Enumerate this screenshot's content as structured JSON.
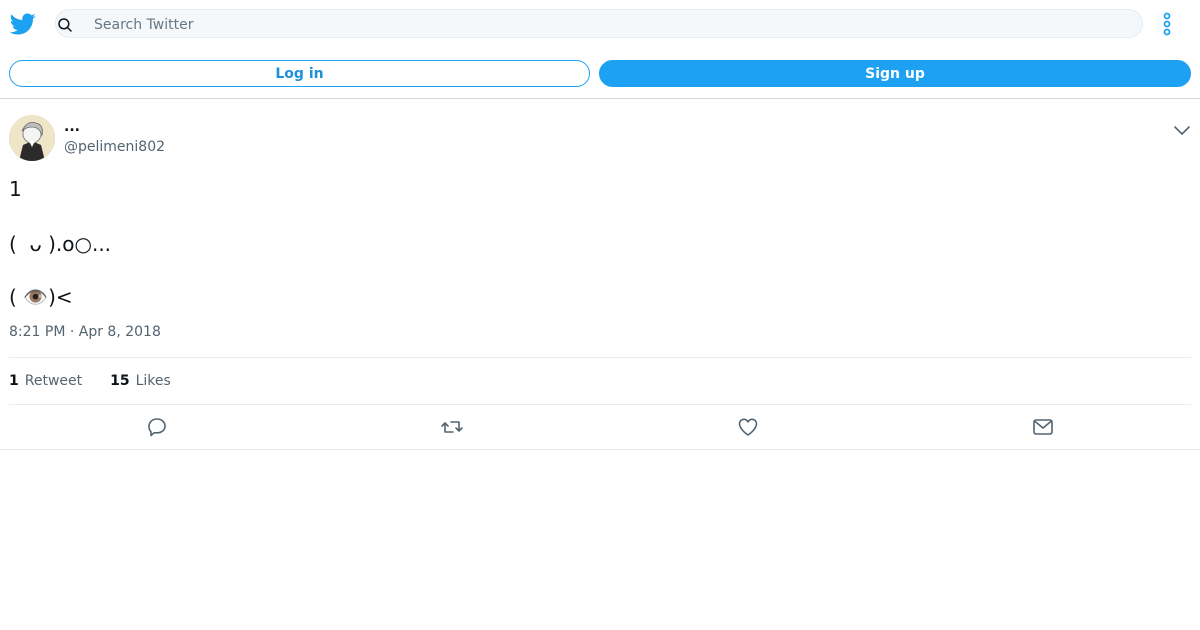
{
  "header": {
    "search_placeholder": "Search Twitter",
    "icons": {
      "logo": "twitter-bird-icon",
      "search": "search-icon",
      "more": "more-vertical-icon"
    }
  },
  "auth": {
    "login_label": "Log in",
    "signup_label": "Sign up"
  },
  "tweet": {
    "display_name": "...",
    "handle": "@pelimeni802",
    "lines": [
      "1",
      "(  ᴗ ).o○...",
      "( 👁️)<"
    ],
    "timestamp": "8:21 PM · Apr 8, 2018",
    "retweet_count": "1",
    "retweet_label": "Retweet",
    "like_count": "15",
    "like_label": "Likes",
    "actions": [
      "reply-icon",
      "retweet-icon",
      "like-icon",
      "share-message-icon"
    ]
  },
  "colors": {
    "accent": "#1da1f2",
    "text": "#0f1419",
    "secondary": "#536471",
    "border": "#e6ecf0"
  }
}
